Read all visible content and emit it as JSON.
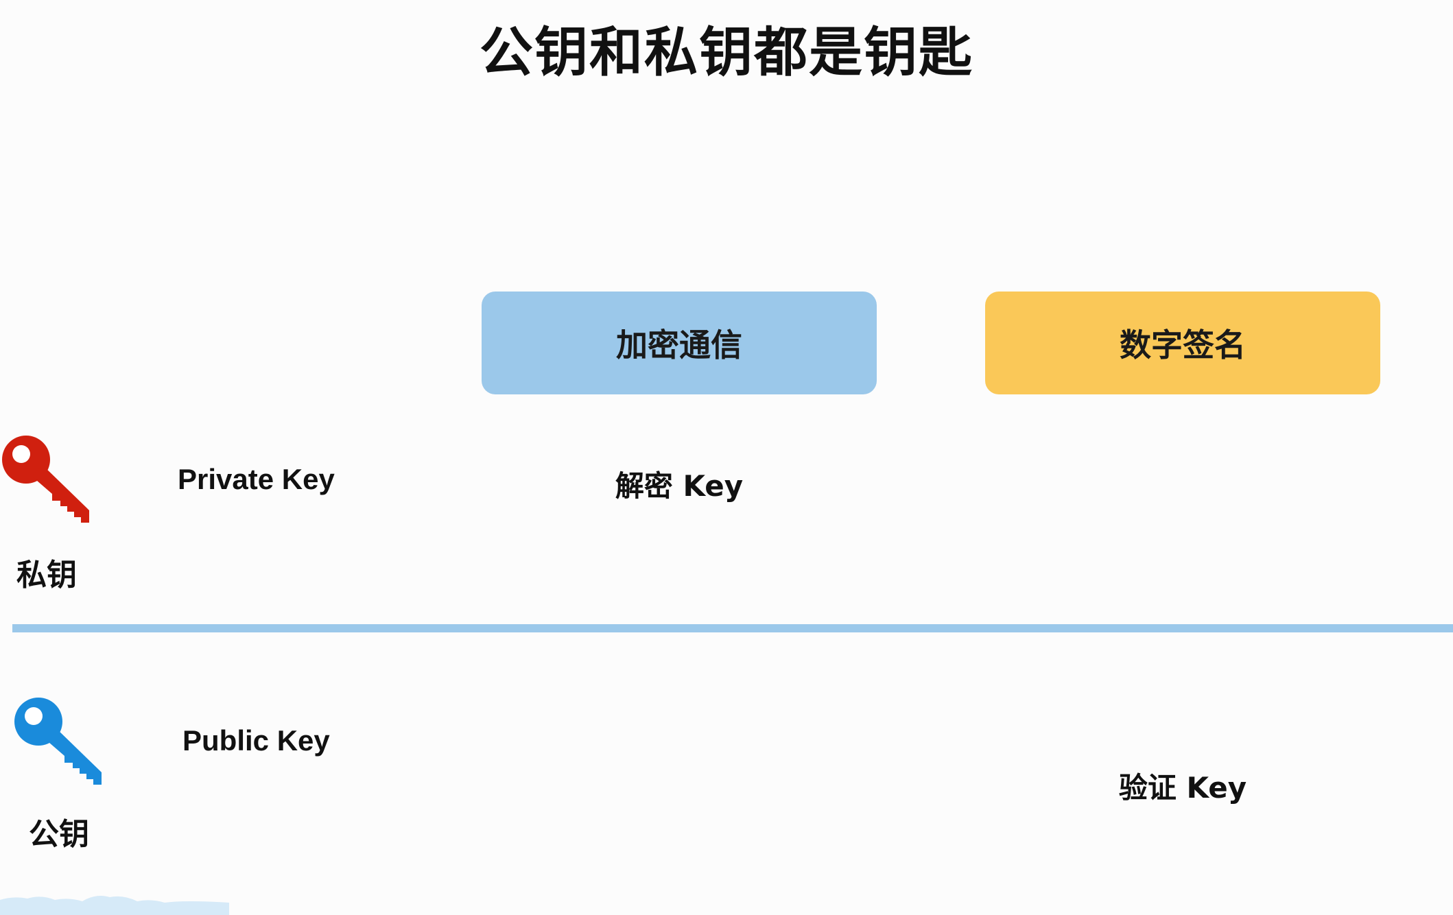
{
  "title": "公钥和私钥都是钥匙",
  "categories": {
    "encrypt": {
      "label": "加密通信",
      "color": "#9bc8ea"
    },
    "sign": {
      "label": "数字签名",
      "color": "#fac858"
    }
  },
  "rows": {
    "private": {
      "icon": "key-icon",
      "icon_color": "#d0200f",
      "caption": "私钥",
      "key_name": "Private Key",
      "encrypt_usage": "解密 Key",
      "sign_usage": ""
    },
    "public": {
      "icon": "key-icon",
      "icon_color": "#1a8bdb",
      "caption": "公钥",
      "key_name": "Public Key",
      "encrypt_usage": "",
      "sign_usage": "验证 Key"
    }
  },
  "divider_color": "#9bc8ea"
}
